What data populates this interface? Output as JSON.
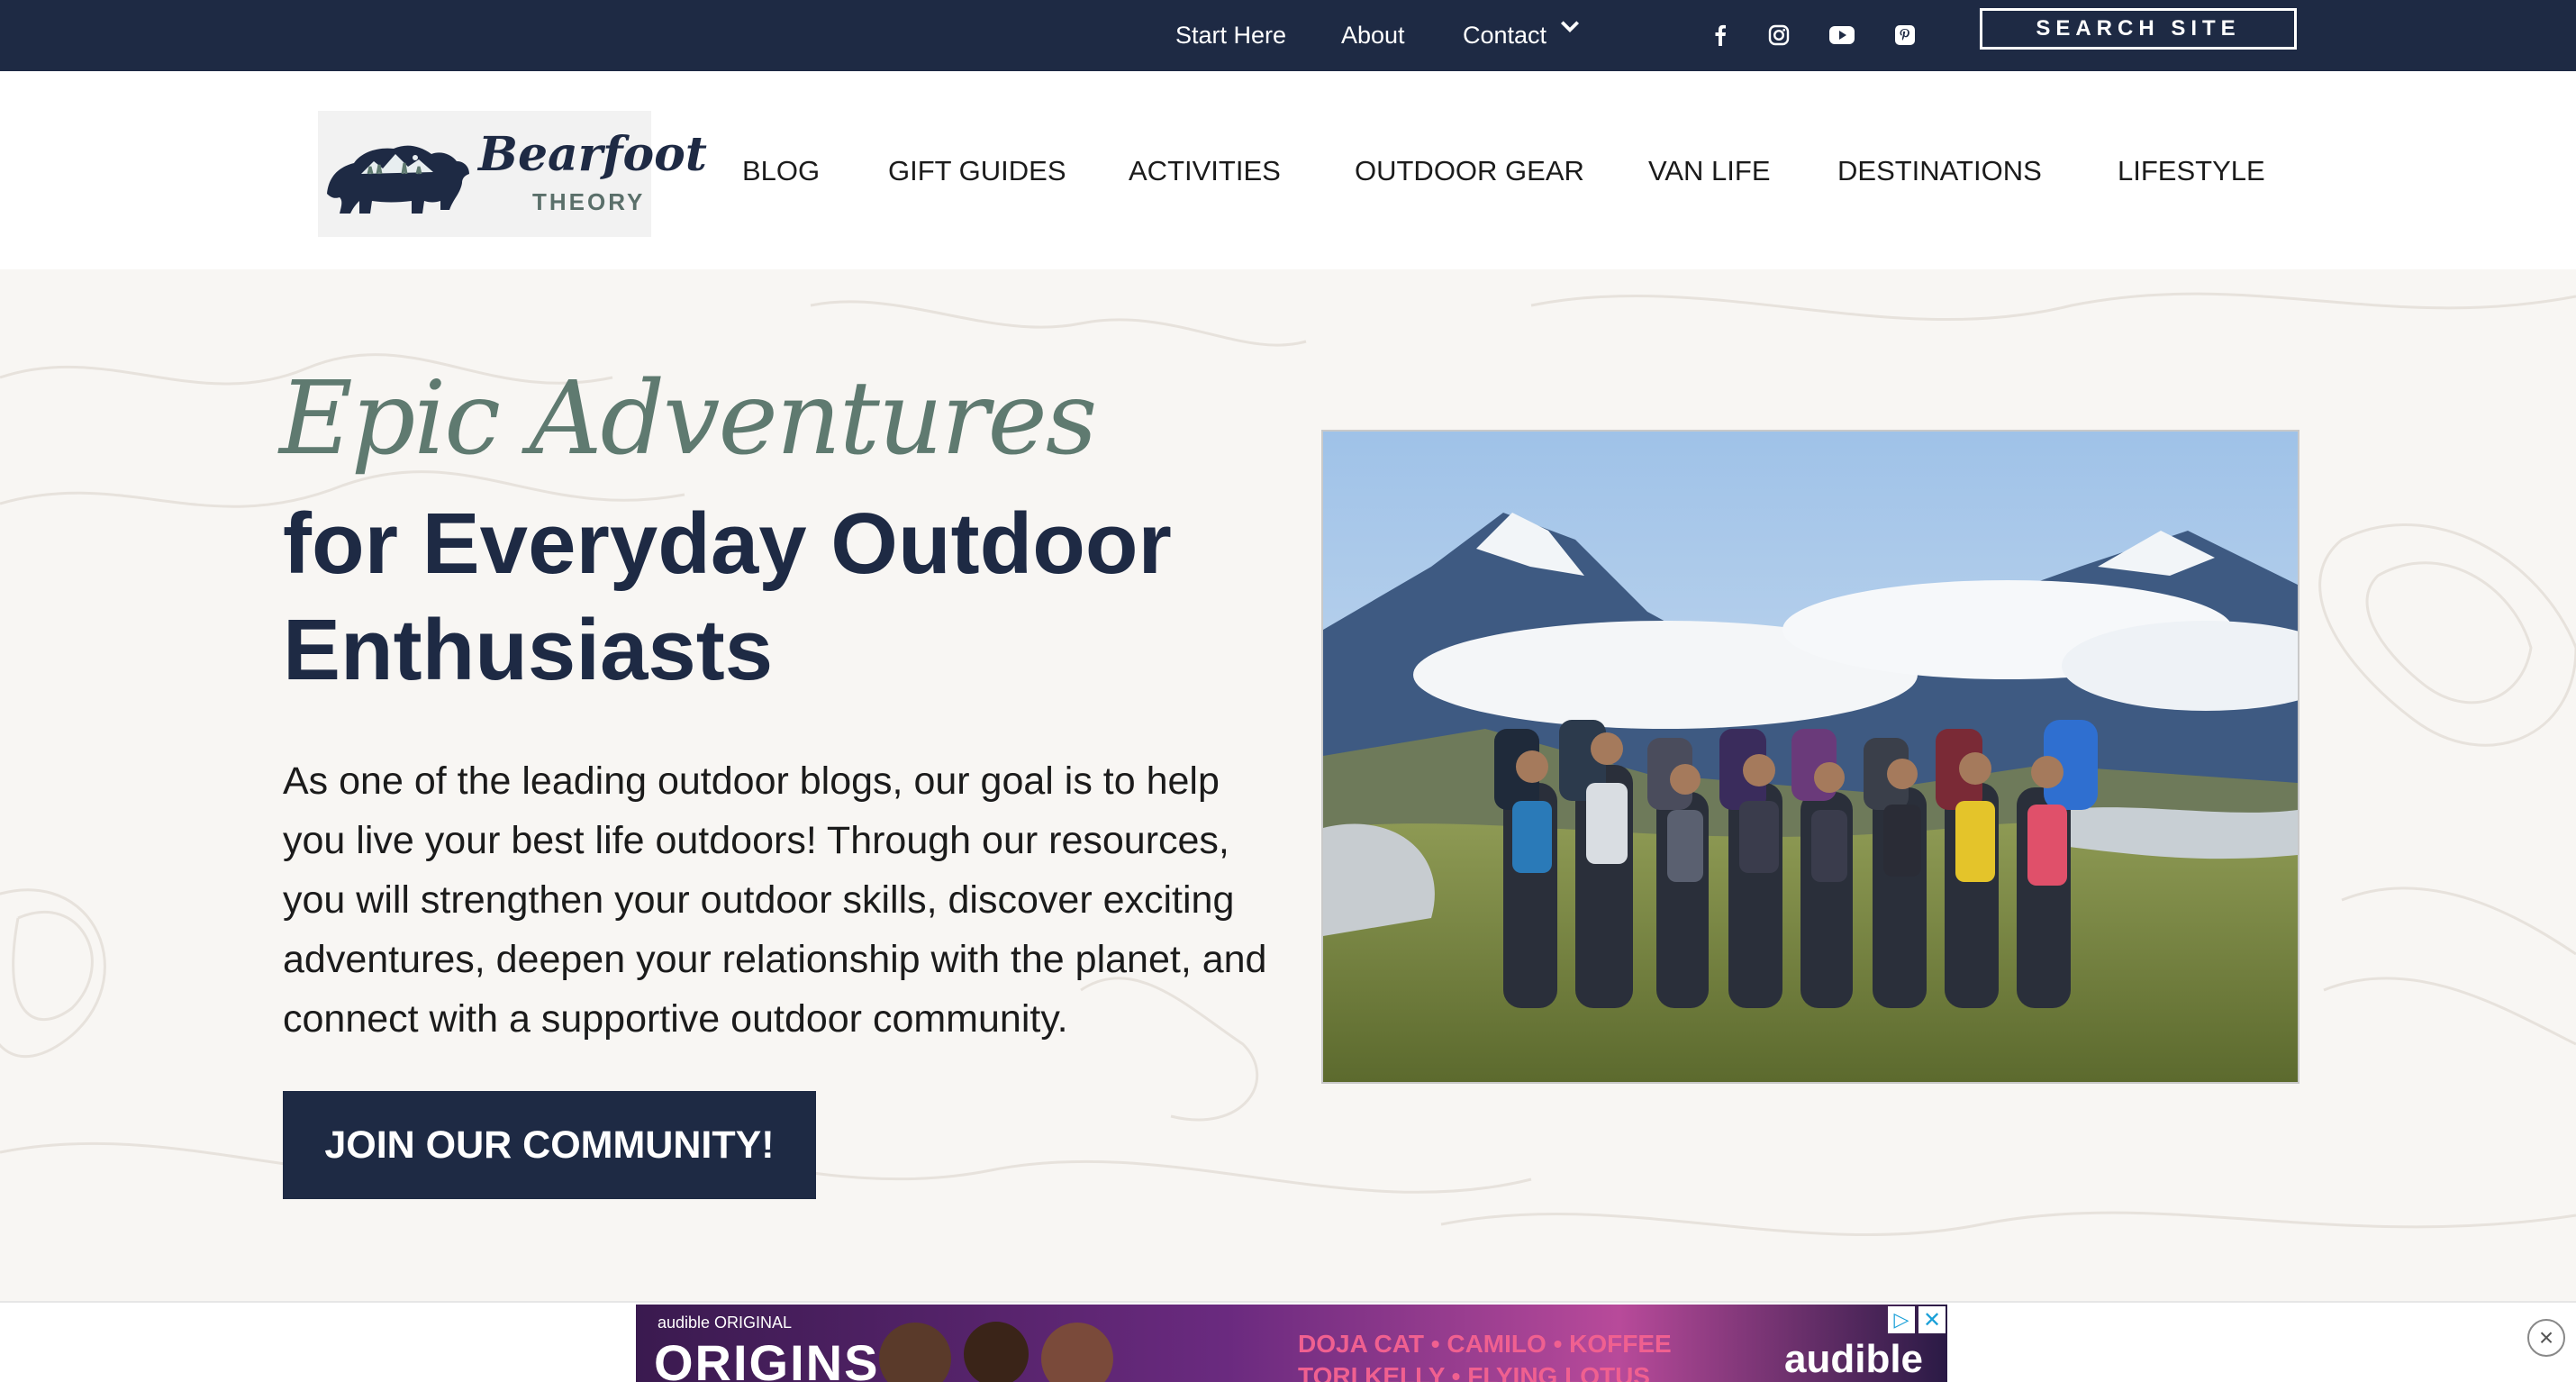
{
  "topbar": {
    "links": [
      "Start Here",
      "About",
      "Contact"
    ],
    "social_icons": [
      "facebook-icon",
      "instagram-icon",
      "youtube-icon",
      "pinterest-icon"
    ],
    "search_label": "SEARCH SITE"
  },
  "logo": {
    "line1": "Bearfoot",
    "line2": "THEORY"
  },
  "main_nav": {
    "items": [
      "BLOG",
      "GIFT GUIDES",
      "ACTIVITIES",
      "OUTDOOR GEAR",
      "VAN LIFE",
      "DESTINATIONS",
      "LIFESTYLE"
    ]
  },
  "hero": {
    "script_title": "Epic Adventures",
    "headline": "for Everyday Outdoor Enthusiasts",
    "body": "As one of the leading outdoor blogs, our goal is to help you live your best life outdoors! Through our resources, you will strengthen your outdoor skills, discover exciting adventures, deepen your relationship with the planet, and connect with a supportive outdoor community.",
    "cta": "JOIN OUR COMMUNITY!"
  },
  "ad": {
    "small_label": "audible ORIGINAL",
    "big_label": "ORIGINS",
    "artists_line1": "DOJA CAT • CAMILO • KOFFEE",
    "artists_line2": "TORI KELLY • FLYING LOTUS",
    "brand": "audible"
  },
  "colors": {
    "navy": "#1e2a44",
    "sage": "#5f7a70",
    "background": "#f8f6f3"
  }
}
